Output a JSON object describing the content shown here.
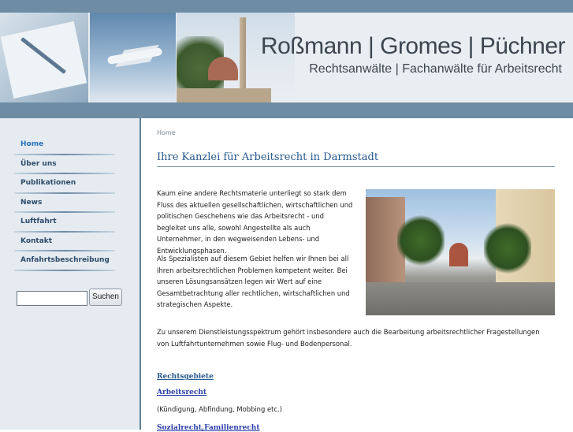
{
  "header": {
    "brand_names": "Roßmann | Gromes | Püchner",
    "brand_subtitle": "Rechtsanwälte | Fachanwälte für Arbeitsrecht"
  },
  "sidebar": {
    "items": [
      {
        "label": "Home",
        "active": true
      },
      {
        "label": "Über uns"
      },
      {
        "label": "Publikationen"
      },
      {
        "label": "News"
      },
      {
        "label": "Luftfahrt"
      },
      {
        "label": "Kontakt"
      },
      {
        "label": "Anfahrtsbeschreibung"
      }
    ],
    "search_button": "Suchen",
    "search_value": ""
  },
  "main": {
    "breadcrumb": "Home",
    "title": "Ihre Kanzlei für Arbeitsrecht in Darmstadt",
    "para1": "Kaum eine andere Rechtsmaterie unterliegt so stark dem Fluss des aktuellen gesellschaftlichen, wirtschaftlichen und politischen Geschehens wie das Arbeitsrecht - und begleitet uns alle, sowohl Angestellte als auch Unternehmer, in den wegweisenden Lebens- und Entwicklungsphasen.",
    "para2": "Als Spezialisten auf diesem Gebiet helfen wir Ihnen bei all Ihren arbeitsrechtlichen Problemen kompetent weiter. Bei unseren Lösungsansätzen legen wir Wert auf eine Gesamtbetrachtung aller rechtlichen, wirtschaftlichen und strategischen Aspekte.",
    "para3": "Zu unserem Dienstleistungsspektrum gehört insbesondere auch die Bearbeitung arbeitsrechtlicher Fragestellungen von Luftfahrtunternehmen sowie Flug- und Bodenpersonal.",
    "link_rechtsgebiete": "Rechtsgebiete",
    "link_arbeitsrecht": "Arbeitsrecht",
    "arbeitsrecht_note": "(Kündigung, Abfindung, Mobbing etc.)",
    "link_sozialrecht": "Sozialrecht,Familienrecht"
  },
  "colors": {
    "bar": "#6e8ca3",
    "link": "#27588d",
    "nav_active": "#2a72b8"
  }
}
